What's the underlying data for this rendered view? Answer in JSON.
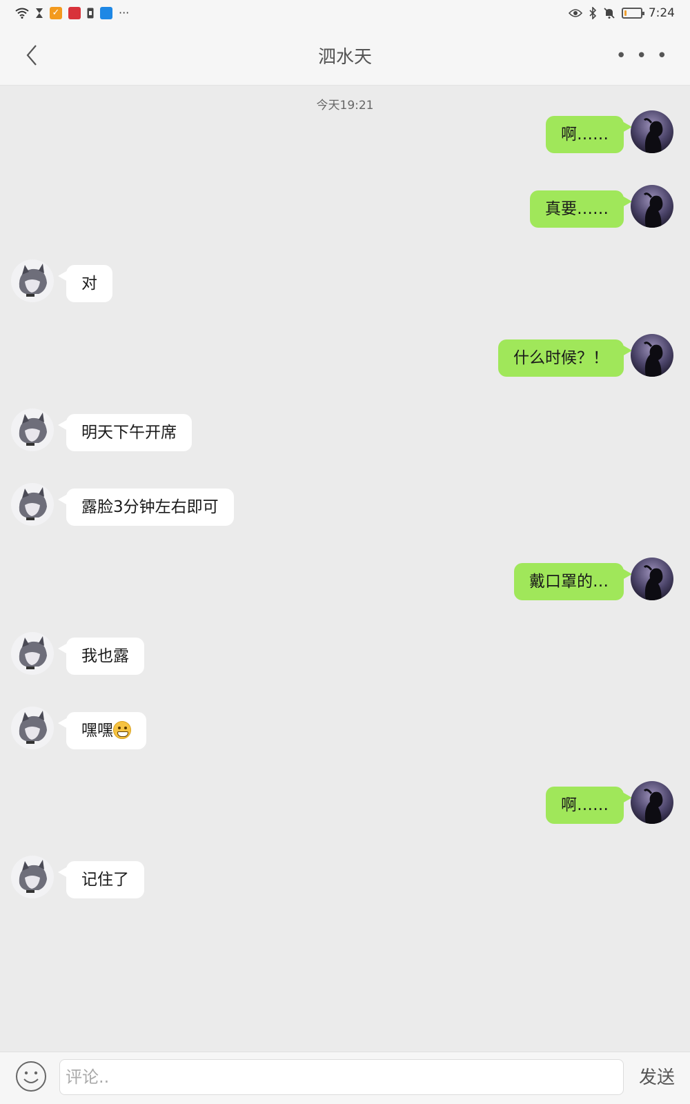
{
  "status_bar": {
    "time": "7:24",
    "left_icons": [
      "wifi-icon",
      "hourglass-icon",
      "check-app-icon",
      "app-icon-red",
      "sim-icon",
      "app-icon-blue",
      "more-dots-icon"
    ],
    "right_icons": [
      "eye-icon",
      "bluetooth-icon",
      "mute-icon",
      "battery-icon"
    ],
    "battery_level": 0.15,
    "more_label": "···"
  },
  "nav": {
    "title": "泗水天",
    "more_label": "• • •"
  },
  "chat": {
    "timestamp": "今天19:21",
    "messages": [
      {
        "side": "sent",
        "text": "啊……"
      },
      {
        "side": "sent",
        "text": "真要……"
      },
      {
        "side": "recv",
        "text": "对"
      },
      {
        "side": "sent",
        "text": "什么时候？！"
      },
      {
        "side": "recv",
        "text": "明天下午开席"
      },
      {
        "side": "recv",
        "text": "露脸3分钟左右即可"
      },
      {
        "side": "sent",
        "text": "戴口罩的…"
      },
      {
        "side": "recv",
        "text": "我也露"
      },
      {
        "side": "recv",
        "text": "嘿嘿",
        "emoji": "grin-emoji"
      },
      {
        "side": "sent",
        "text": "啊……"
      },
      {
        "side": "recv",
        "text": "记住了"
      }
    ]
  },
  "input": {
    "placeholder": "评论..",
    "value": "",
    "send_label": "发送"
  },
  "colors": {
    "sent_bubble": "#a0e75a",
    "recv_bubble": "#ffffff",
    "background": "#ebebeb"
  }
}
